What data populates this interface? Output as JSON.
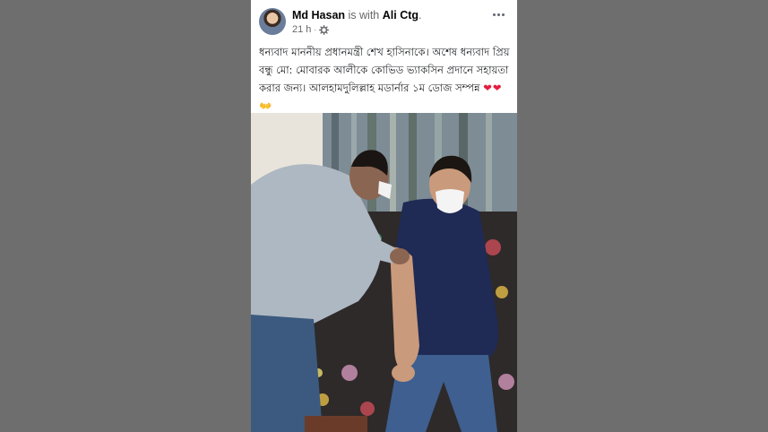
{
  "post": {
    "author_name": "Md Hasan",
    "with_text": "is with",
    "tagged_name": "Ali Ctg",
    "tagged_suffix": ".",
    "time": "21 h",
    "meta_separator": "·",
    "audience_icon": "gear-icon",
    "more_icon": "more-options-icon",
    "text": "ধন্যবাদ মাননীয় প্রধানমন্ত্রী শেখ হাসিনাকে। অশেষ ধন্যবাদ প্রিয় বন্ধু মো: মোবারক আলীকে কোভিড ভ্যাকসিন প্রদানে সহায়তা করার জন্য। আলহামদুলিল্লাহ মডার্নার ১ম ডোজ সম্পন্ন",
    "hearts": "❤❤",
    "hands": "👐",
    "photo_description_icon": "photo"
  },
  "colors": {
    "background": "#6e6e6e",
    "card": "#ffffff",
    "name": "#050505",
    "secondary_text": "#65676b",
    "heart": "#e41e3f"
  }
}
